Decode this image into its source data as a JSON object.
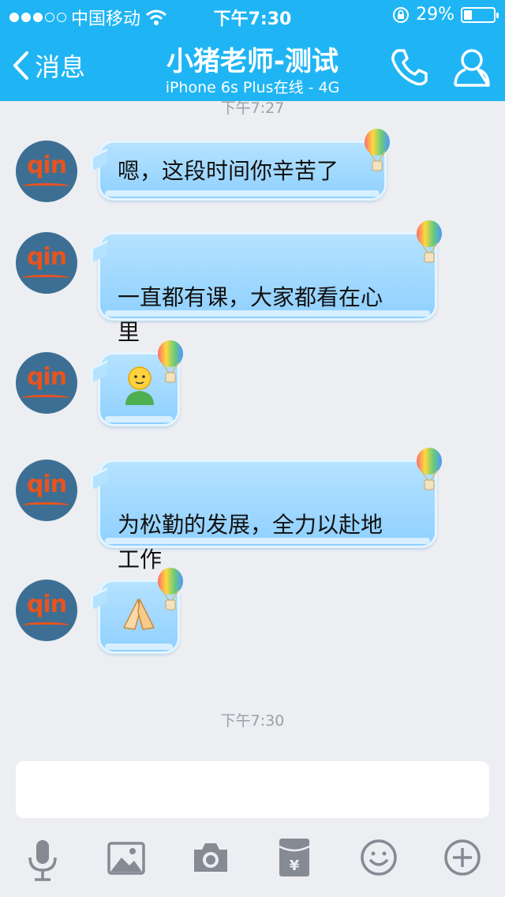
{
  "status_bar": {
    "carrier": "中国移动",
    "time": "下午7:30",
    "battery_text": "29%",
    "battery_level": 0.29
  },
  "nav": {
    "back_label": "消息",
    "title": "小猪老师-测试",
    "subtitle": "iPhone 6s Plus在线 - 4G"
  },
  "timestamps": [
    "下午7:27",
    "下午7:30"
  ],
  "messages": [
    {
      "text": "嗯，这段时间你辛苦了"
    },
    {
      "text": "一直都有课，大家都看在心\n里"
    },
    {
      "emoji": "🧑"
    },
    {
      "text": "为松勤的发展，全力以赴地\n工作"
    },
    {
      "emoji": "🙏"
    }
  ],
  "avatar_text": "qin",
  "colors": {
    "header": "#1fb5f4",
    "bubble": "#a3d9ff",
    "background": "#eceef2",
    "toolbar_icon": "#858a93"
  },
  "toolbar_icons": [
    "microphone-icon",
    "image-icon",
    "camera-icon",
    "red-packet-icon",
    "emoji-icon",
    "plus-icon"
  ]
}
